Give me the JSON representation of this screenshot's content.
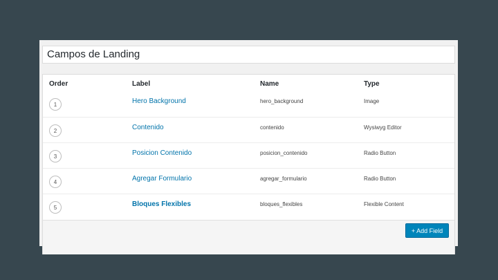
{
  "group_title": "Campos de Landing",
  "columns": {
    "order": "Order",
    "label": "Label",
    "name": "Name",
    "type": "Type"
  },
  "rows": [
    {
      "order": "1",
      "label": "Hero Background",
      "name": "hero_background",
      "type": "Image"
    },
    {
      "order": "2",
      "label": "Contenido",
      "name": "contenido",
      "type": "Wysiwyg Editor"
    },
    {
      "order": "3",
      "label": "Posicion Contenido",
      "name": "posicion_contenido",
      "type": "Radio Button"
    },
    {
      "order": "4",
      "label": "Agregar Formulario",
      "name": "agregar_formulario",
      "type": "Radio Button"
    },
    {
      "order": "5",
      "label": "Bloques Flexibles",
      "name": "bloques_flexibles",
      "type": "Flexible Content"
    }
  ],
  "add_field_label": "+ Add Field",
  "colors": {
    "background": "#37474f",
    "link": "#0073aa",
    "button": "#0085ba"
  }
}
